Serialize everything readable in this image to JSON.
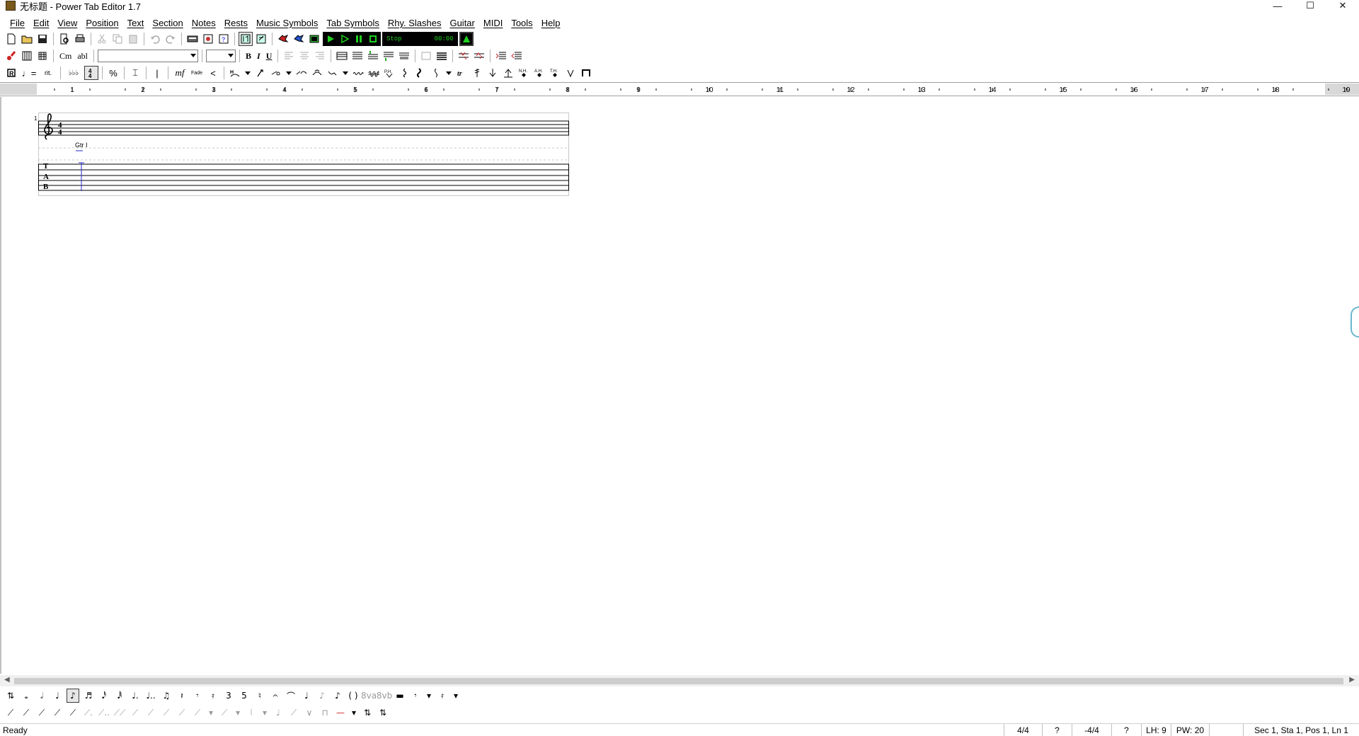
{
  "window": {
    "title": "无标题 - Power Tab Editor 1.7",
    "controls": {
      "minimize": "—",
      "maximize": "☐",
      "close": "✕"
    }
  },
  "menu": {
    "items": [
      "File",
      "Edit",
      "View",
      "Position",
      "Text",
      "Section",
      "Notes",
      "Rests",
      "Music Symbols",
      "Tab Symbols",
      "Rhy. Slashes",
      "Guitar",
      "MIDI",
      "Tools",
      "Help"
    ]
  },
  "toolbar2": {
    "chord_btn": "Cm",
    "text_btn": "abl",
    "font_combo_value": "",
    "size_combo_value": "",
    "bold": "B",
    "italic": "I",
    "underline": "U"
  },
  "playback": {
    "status": "Stop",
    "time": "00:00"
  },
  "ruler": {
    "numbers": [
      "1",
      "2",
      "3",
      "4",
      "5",
      "6",
      "7",
      "8",
      "9",
      "10",
      "11",
      "12",
      "13",
      "14",
      "15",
      "16",
      "17",
      "18",
      "19"
    ]
  },
  "score": {
    "system_number": "1",
    "time_signature": "4/4",
    "guitar_label": "Gtr I",
    "tab_letters": [
      "T",
      "A",
      "B"
    ]
  },
  "palette1": {
    "items": [
      "♩=",
      "rit.",
      "♭♭♭",
      "𝄐",
      "%",
      "⌶",
      "|",
      "mf",
      "Fade",
      "<"
    ]
  },
  "statusbar": {
    "text": "Ready",
    "time_signature": "4/4",
    "unknown1": "?",
    "key_signature": "-4/4",
    "unknown2": "?",
    "lh": "LH: 9",
    "pw": "PW: 20",
    "position": "Sec 1, Sta 1, Pos 1, Ln 1"
  },
  "colors": {
    "lcd_background": "#000000",
    "lcd_text": "#1fd01f",
    "cursor_blue": "#2a2ad0",
    "toolbar_gray": "#9a9a9a"
  }
}
